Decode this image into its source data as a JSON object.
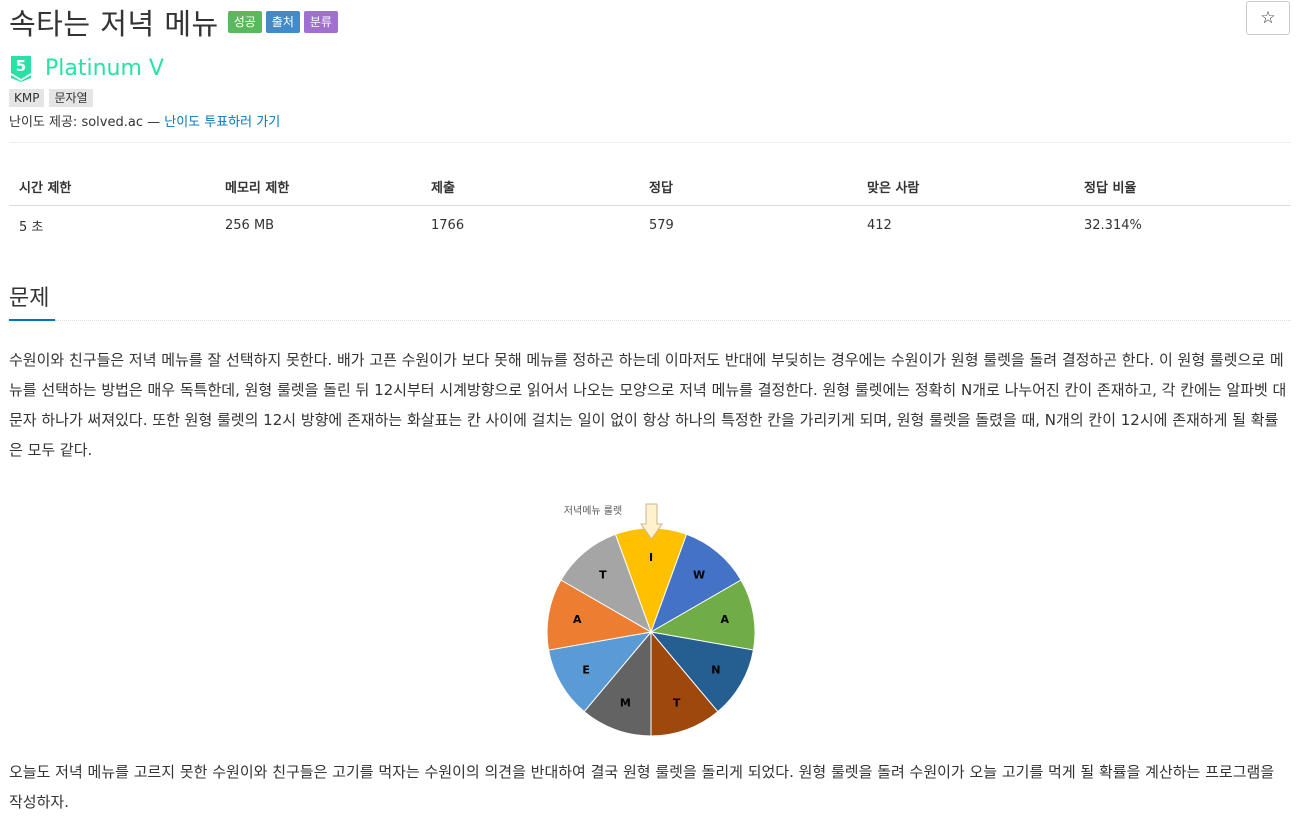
{
  "problem": {
    "title": "속타는 저녁 메뉴",
    "labels": {
      "success": "성공",
      "source": "출처",
      "category": "분류"
    },
    "star": "☆"
  },
  "tier": {
    "badge_number": "5",
    "name": "Platinum V",
    "color": "#27e2a4"
  },
  "tags": [
    "KMP",
    "문자열"
  ],
  "difficulty": {
    "prefix": "난이도 제공: solved.ac — ",
    "vote_link": "난이도 투표하러 가기"
  },
  "stats": {
    "headers": [
      "시간 제한",
      "메모리 제한",
      "제출",
      "정답",
      "맞은 사람",
      "정답 비율"
    ],
    "values": [
      "5 초",
      "256 MB",
      "1766",
      "579",
      "412",
      "32.314%"
    ]
  },
  "section": {
    "title": "문제"
  },
  "description": {
    "paragraph1": "수원이와 친구들은 저녁 메뉴를 잘 선택하지 못한다. 배가 고픈 수원이가 보다 못해 메뉴를 정하곤 하는데 이마저도 반대에 부딪히는 경우에는 수원이가 원형 룰렛을 돌려 결정하곤 한다. 이 원형 룰렛으로 메뉴를 선택하는 방법은 매우 독특한데, 원형 룰렛을 돌린 뒤 12시부터 시계방향으로 읽어서 나오는 모양으로 저녁 메뉴를 결정한다. 원형 룰렛에는 정확히 N개로 나누어진 칸이 존재하고, 각 칸에는 알파벳 대문자 하나가 써져있다. 또한 원형 룰렛의 12시 방향에 존재하는 화살표는 칸 사이에 걸치는 일이 없이 항상 하나의 특정한 칸을 가리키게 되며, 원형 룰렛을 돌렸을 때, N개의 칸이 12시에 존재하게 될 확률은 모두 같다.",
    "paragraph2": "오늘도 저녁 메뉴를 고르지 못한 수원이와 친구들은 고기를 먹자는 수원이의 의견을 반대하여 결국 원형 룰렛을 돌리게 되었다. 원형 룰렛을 돌려 수원이가 오늘 고기를 먹게 될 확률을 계산하는 프로그램을 작성하자."
  },
  "roulette": {
    "caption": "저녁메뉴 룰렛",
    "slices": [
      {
        "letter": "I",
        "color": "#ffc000"
      },
      {
        "letter": "W",
        "color": "#4472c4"
      },
      {
        "letter": "A",
        "color": "#70ad47"
      },
      {
        "letter": "N",
        "color": "#255e91"
      },
      {
        "letter": "T",
        "color": "#9e480e"
      },
      {
        "letter": "M",
        "color": "#636363"
      },
      {
        "letter": "E",
        "color": "#5b9bd5"
      },
      {
        "letter": "A",
        "color": "#ed7d31"
      },
      {
        "letter": "T",
        "color": "#a5a5a5"
      }
    ]
  }
}
